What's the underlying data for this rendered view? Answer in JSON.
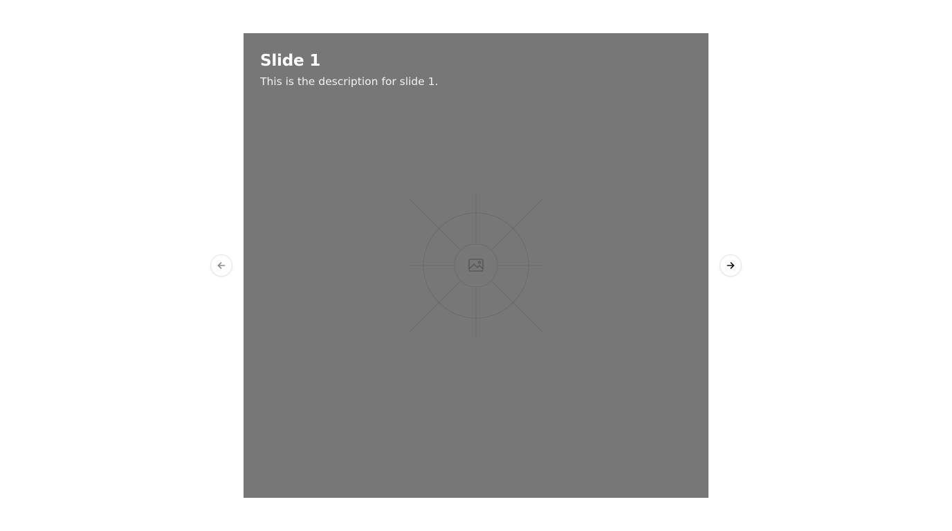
{
  "carousel": {
    "slides": [
      {
        "title": "Slide 1",
        "description": "This is the description for slide 1.",
        "image": "image-placeholder-icon"
      }
    ],
    "controls": {
      "previous_icon": "arrow-left-icon",
      "next_icon": "arrow-right-icon",
      "previous_disabled": true
    }
  },
  "colors": {
    "slide_background": "#777777",
    "placeholder_lines": "#6a6a6a",
    "button_border": "#e4e4e7",
    "icon": "#111111"
  }
}
